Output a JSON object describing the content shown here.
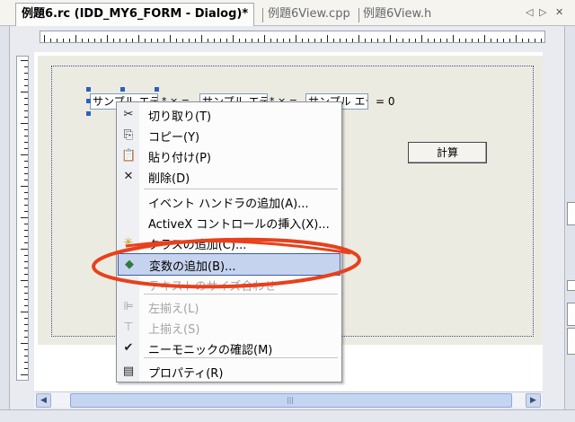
{
  "tabs": [
    {
      "label": "例題6.rc (IDD_MY6_FORM - Dialog)*",
      "active": true
    },
    {
      "label": "例題6View.cpp",
      "active": false
    },
    {
      "label": "例題6View.h",
      "active": false
    }
  ],
  "tab_controls": {
    "prev": "◁",
    "next": "▷",
    "close": "✕"
  },
  "dialog": {
    "edit1": "サンプル エデ",
    "op1": "* × =",
    "edit2": "サンプル エデ",
    "op2": "* × =",
    "edit3": "サンプル エデ",
    "equals": "= 0",
    "calc_button": "計算"
  },
  "context_menu": {
    "items": [
      {
        "label": "切り取り(T)",
        "icon": "scissors-icon",
        "glyph": "✂",
        "enabled": true
      },
      {
        "label": "コピー(Y)",
        "icon": "copy-icon",
        "glyph": "⎘",
        "enabled": true
      },
      {
        "label": "貼り付け(P)",
        "icon": "paste-icon",
        "glyph": "📋",
        "enabled": true
      },
      {
        "label": "削除(D)",
        "icon": "delete-icon",
        "glyph": "✕",
        "enabled": true
      },
      {
        "label": "イベント ハンドラの追加(A)...",
        "icon": "",
        "glyph": "",
        "enabled": true
      },
      {
        "label": "ActiveX コントロールの挿入(X)...",
        "icon": "",
        "glyph": "",
        "enabled": true
      },
      {
        "label": "クラスの追加(C)...",
        "icon": "add-class-icon",
        "glyph": "✳",
        "enabled": true
      },
      {
        "label": "変数の追加(B)...",
        "icon": "add-variable-icon",
        "glyph": "◆",
        "enabled": true,
        "highlighted": true
      },
      {
        "label": "テキストのサイズ合わせ",
        "icon": "",
        "glyph": "",
        "enabled": false
      },
      {
        "label": "左揃え(L)",
        "icon": "align-left-icon",
        "glyph": "⊫",
        "enabled": false
      },
      {
        "label": "上揃え(S)",
        "icon": "align-top-icon",
        "glyph": "⊤",
        "enabled": false
      },
      {
        "label": "ニーモニックの確認(M)",
        "icon": "check-mnemonic-icon",
        "glyph": "✔",
        "enabled": true
      },
      {
        "label": "プロパティ(R)",
        "icon": "properties-icon",
        "glyph": "▤",
        "enabled": true
      }
    ]
  },
  "colors": {
    "highlight_fill": "#c6d3ee",
    "highlight_border": "#3b5ea8",
    "annotation": "#e8401c",
    "selection_handle": "#2d5fbf"
  },
  "scrollbar": {
    "left_arrow": "◀",
    "right_arrow": "▶",
    "grip": "|||"
  }
}
